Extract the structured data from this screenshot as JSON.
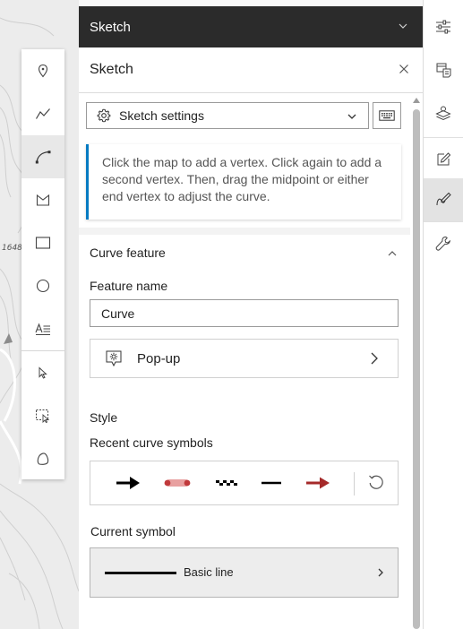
{
  "map": {
    "elevation_label": "1648"
  },
  "toolbar": {
    "tools": [
      {
        "name": "point-tool"
      },
      {
        "name": "polyline-tool"
      },
      {
        "name": "curve-tool",
        "active": true
      },
      {
        "name": "polygon-tool"
      },
      {
        "name": "rectangle-tool"
      },
      {
        "name": "circle-tool"
      },
      {
        "name": "text-tool"
      },
      {
        "name": "select-tool"
      },
      {
        "name": "rectangle-select-tool"
      },
      {
        "name": "lasso-select-tool"
      }
    ]
  },
  "panel": {
    "header_title": "Sketch",
    "title": "Sketch",
    "settings_label": "Sketch settings",
    "notice": "Click the map to add a vertex. Click again to add a second vertex. Then, drag the midpoint or either end vertex to adjust the curve.",
    "curve_section": {
      "title": "Curve feature",
      "feature_name_label": "Feature name",
      "feature_name_value": "Curve",
      "popup_label": "Pop-up"
    },
    "style_section": {
      "title": "Style",
      "recent_label": "Recent curve symbols",
      "recent_symbols": [
        {
          "name": "black-arrow-symbol",
          "color": "#000000"
        },
        {
          "name": "red-dot-line-symbol",
          "color": "#c0393b"
        },
        {
          "name": "checkered-line-symbol",
          "color": "#000000"
        },
        {
          "name": "black-dash-symbol",
          "color": "#000000"
        },
        {
          "name": "red-arrow-symbol",
          "color": "#a52a2a"
        }
      ],
      "current_label": "Current symbol",
      "current_symbol_label": "Basic line"
    }
  },
  "rail": {
    "buttons": [
      {
        "name": "properties-icon"
      },
      {
        "name": "data-icon"
      },
      {
        "name": "layers-icon"
      },
      {
        "name": "edit-icon"
      },
      {
        "name": "sketch-icon",
        "active": true
      },
      {
        "name": "tools-icon"
      }
    ]
  },
  "colors": {
    "accent": "#007ac2",
    "header_bg": "#2b2b2b"
  }
}
